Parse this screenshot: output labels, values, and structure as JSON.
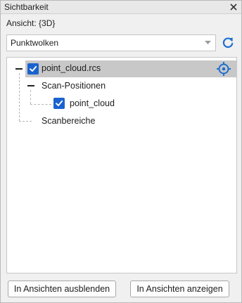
{
  "window": {
    "title": "Sichtbarkeit"
  },
  "view": {
    "label": "Ansicht: {3D}"
  },
  "dropdown": {
    "value": "Punktwolken"
  },
  "tree": {
    "items": [
      {
        "label": "point_cloud.rcs",
        "checked": true,
        "selected": true
      },
      {
        "label": "Scan-Positionen"
      },
      {
        "label": "point_cloud",
        "checked": true
      },
      {
        "label": "Scanbereiche"
      }
    ]
  },
  "buttons": {
    "hide_label": "In Ansichten ausblenden",
    "show_label": "In Ansichten anzeigen"
  },
  "colors": {
    "accent": "#1a63cf",
    "selection": "#c8c8c8",
    "refresh": "#1f6fd1"
  }
}
